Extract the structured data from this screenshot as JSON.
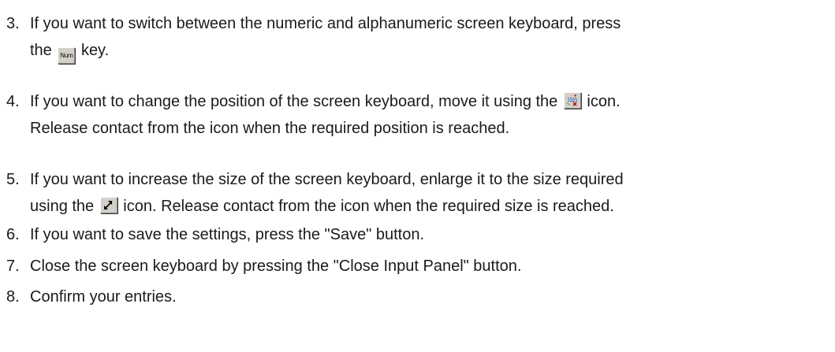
{
  "steps": [
    {
      "number": "3.",
      "line1_before": "If you want to switch between the numeric and alphanumeric screen keyboard, press",
      "line2_before": "the",
      "line2_after": "key.",
      "icon": "num-key-icon",
      "icon_label": "Num"
    },
    {
      "number": "4.",
      "line1_before": "If you want to change the position of the screen keyboard, move it using the",
      "line1_after": "icon.",
      "line2": "Release contact from the icon when the required position is reached.",
      "icon": "move-keyboard-icon"
    },
    {
      "number": "5.",
      "line1": "If you want to increase the size of the screen keyboard, enlarge it to the size required",
      "line2_before": "using the",
      "line2_after": "icon. Release contact from the icon when the required size is reached.",
      "icon": "resize-icon"
    },
    {
      "number": "6.",
      "text": "If you want to save the settings, press the \"Save\" button."
    },
    {
      "number": "7.",
      "text": "Close the screen keyboard by pressing the \"Close Input Panel\" button."
    },
    {
      "number": "8.",
      "text": "Confirm your entries."
    }
  ]
}
